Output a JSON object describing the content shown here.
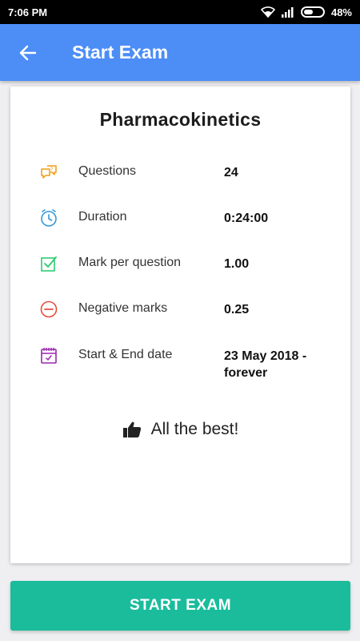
{
  "status_bar": {
    "time": "7:06 PM",
    "battery_percent": "48%",
    "battery_level": 0.48,
    "icons": [
      "wifi-icon",
      "signal-icon",
      "battery-icon"
    ]
  },
  "app_bar": {
    "title": "Start Exam",
    "color": "#4c8df6",
    "back_icon": "arrow-back-icon"
  },
  "exam": {
    "title": "Pharmacokinetics",
    "details": [
      {
        "icon": "questions-icon",
        "icon_color": "#f39c12",
        "label": "Questions",
        "value": "24"
      },
      {
        "icon": "clock-icon",
        "icon_color": "#3498db",
        "label": "Duration",
        "value": "0:24:00"
      },
      {
        "icon": "checkbox-icon",
        "icon_color": "#2ecc71",
        "label": "Mark per question",
        "value": "1.00"
      },
      {
        "icon": "minus-circle-icon",
        "icon_color": "#e74c3c",
        "label": "Negative marks",
        "value": "0.25"
      },
      {
        "icon": "calendar-icon",
        "icon_color": "#9b27b0",
        "label": "Start & End date",
        "value": "23 May 2018 - forever"
      }
    ],
    "wish": "All the best!",
    "wish_icon": "thumbs-up-icon"
  },
  "actions": {
    "start_label": "START EXAM",
    "start_color": "#1abc9c"
  }
}
